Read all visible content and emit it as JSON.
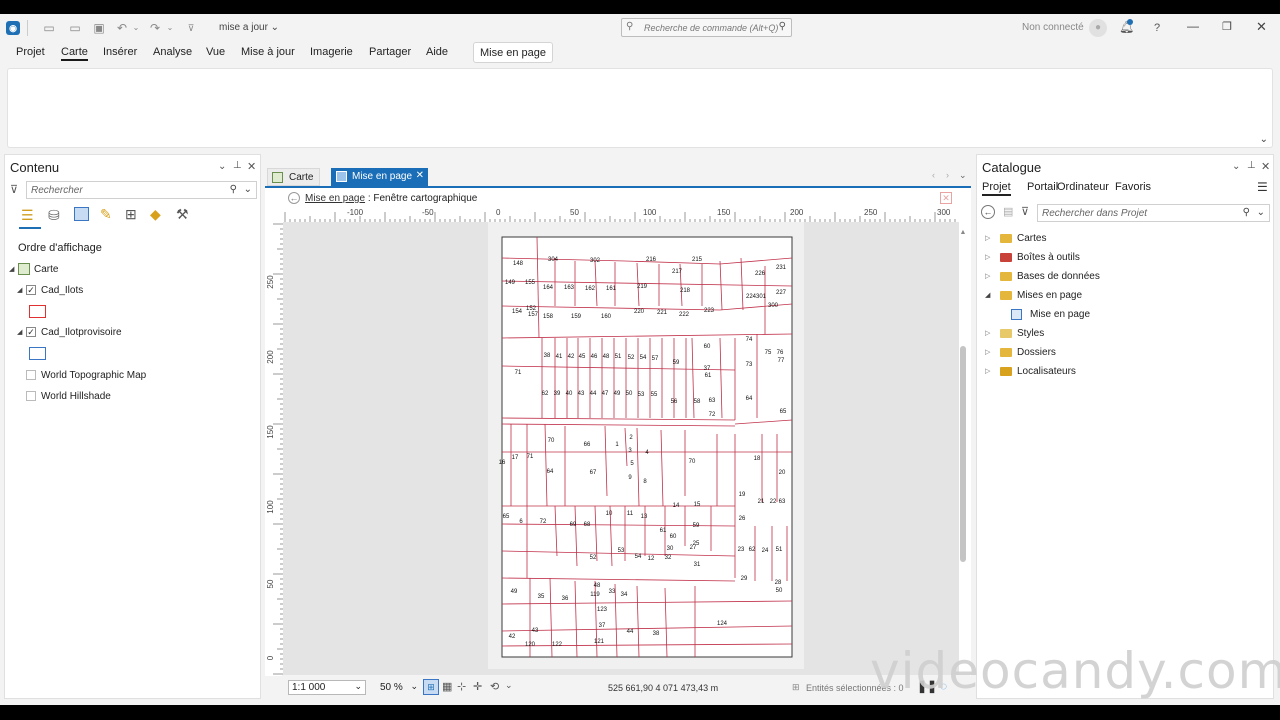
{
  "titlebar": {
    "doc_title": "mise a jour",
    "command_search_placeholder": "Recherche de commande (Alt+Q)",
    "sign_in_status": "Non connecté",
    "help_label": "?"
  },
  "menu": {
    "items": [
      "Projet",
      "Carte",
      "Insérer",
      "Analyse",
      "Vue",
      "Mise à jour",
      "Imagerie",
      "Partager",
      "Aide"
    ],
    "active": "Carte",
    "contextual_tab": "Mise en page"
  },
  "contents": {
    "title": "Contenu",
    "search_placeholder": "Rechercher",
    "drawing_order_heading": "Ordre d'affichage",
    "map_label": "Carte",
    "layers": [
      {
        "name": "Cad_Ilots",
        "checked": true,
        "symbol_color": "#e03030"
      },
      {
        "name": "Cad_Ilotprovisoire",
        "checked": true,
        "symbol_color": "#3a76c4"
      },
      {
        "name": "World Topographic Map",
        "checked": false
      },
      {
        "name": "World Hillshade",
        "checked": false
      }
    ]
  },
  "views": {
    "tabs": [
      {
        "label": "Carte",
        "active": false
      },
      {
        "label": "Mise en page",
        "active": true
      }
    ],
    "breadcrumb_link": "Mise en page",
    "breadcrumb_sep": ":",
    "breadcrumb_current": "Fenêtre cartographique"
  },
  "ruler": {
    "top_labels": [
      "-100",
      "-50",
      "0",
      "50",
      "100",
      "150",
      "200",
      "250",
      "300"
    ],
    "left_labels": [
      "250",
      "200",
      "150",
      "100",
      "50",
      "0"
    ]
  },
  "map": {
    "parcel_labels": [
      "148",
      "304",
      "302",
      "216",
      "215",
      "217",
      "226",
      "231",
      "149",
      "155",
      "164",
      "163",
      "162",
      "161",
      "219",
      "218",
      "227",
      "224",
      "301",
      "300",
      "154",
      "152",
      "157",
      "158",
      "159",
      "160",
      "220",
      "221",
      "222",
      "223",
      "74",
      "60",
      "75",
      "76",
      "77",
      "71",
      "38",
      "41",
      "42",
      "45",
      "46",
      "48",
      "51",
      "52",
      "54",
      "57",
      "59",
      "73",
      "37",
      "61",
      "62",
      "39",
      "40",
      "43",
      "44",
      "47",
      "49",
      "50",
      "53",
      "55",
      "56",
      "58",
      "63",
      "64",
      "72",
      "65",
      "70",
      "66",
      "1",
      "2",
      "3",
      "5",
      "4",
      "17",
      "71",
      "70",
      "18",
      "64",
      "67",
      "9",
      "8",
      "16",
      "20",
      "65",
      "6",
      "72",
      "69",
      "68",
      "10",
      "11",
      "13",
      "14",
      "15",
      "19",
      "21",
      "22",
      "63",
      "61",
      "60",
      "59",
      "26",
      "25",
      "23",
      "62",
      "24",
      "51",
      "52",
      "53",
      "54",
      "12",
      "32",
      "31",
      "30",
      "27",
      "29",
      "28",
      "50",
      "49",
      "48",
      "119",
      "33",
      "34",
      "35",
      "36",
      "123",
      "124",
      "37",
      "44",
      "38",
      "42",
      "43",
      "120",
      "122",
      "121",
      "125",
      "39"
    ]
  },
  "status": {
    "scale": "1:1 000",
    "zoom": "50 %",
    "coordinates": "525 661,90 4 071 473,43 m",
    "selected_features": "Entités sélectionnées : 0"
  },
  "catalog": {
    "title": "Catalogue",
    "tabs": [
      "Projet",
      "Portail",
      "Ordinateur",
      "Favoris"
    ],
    "active_tab": "Projet",
    "search_placeholder": "Rechercher dans Projet",
    "items": [
      {
        "label": "Cartes",
        "icon": "maps-folder-icon",
        "expanded": false,
        "level": 0
      },
      {
        "label": "Boîtes à outils",
        "icon": "toolbox-folder-icon",
        "expanded": false,
        "level": 0
      },
      {
        "label": "Bases de données",
        "icon": "database-folder-icon",
        "expanded": false,
        "level": 0
      },
      {
        "label": "Mises en page",
        "icon": "layouts-folder-icon",
        "expanded": true,
        "level": 0
      },
      {
        "label": "Mise en page",
        "icon": "layout-icon",
        "expanded": false,
        "level": 1
      },
      {
        "label": "Styles",
        "icon": "styles-folder-icon",
        "expanded": false,
        "level": 0
      },
      {
        "label": "Dossiers",
        "icon": "folders-folder-icon",
        "expanded": false,
        "level": 0
      },
      {
        "label": "Localisateurs",
        "icon": "locators-folder-icon",
        "expanded": false,
        "level": 0
      }
    ]
  },
  "watermark": "videocandy.com",
  "colors": {
    "accent": "#1f6fb5",
    "parcel_line": "#c0304a",
    "active_tab": "#1a6eb8"
  }
}
